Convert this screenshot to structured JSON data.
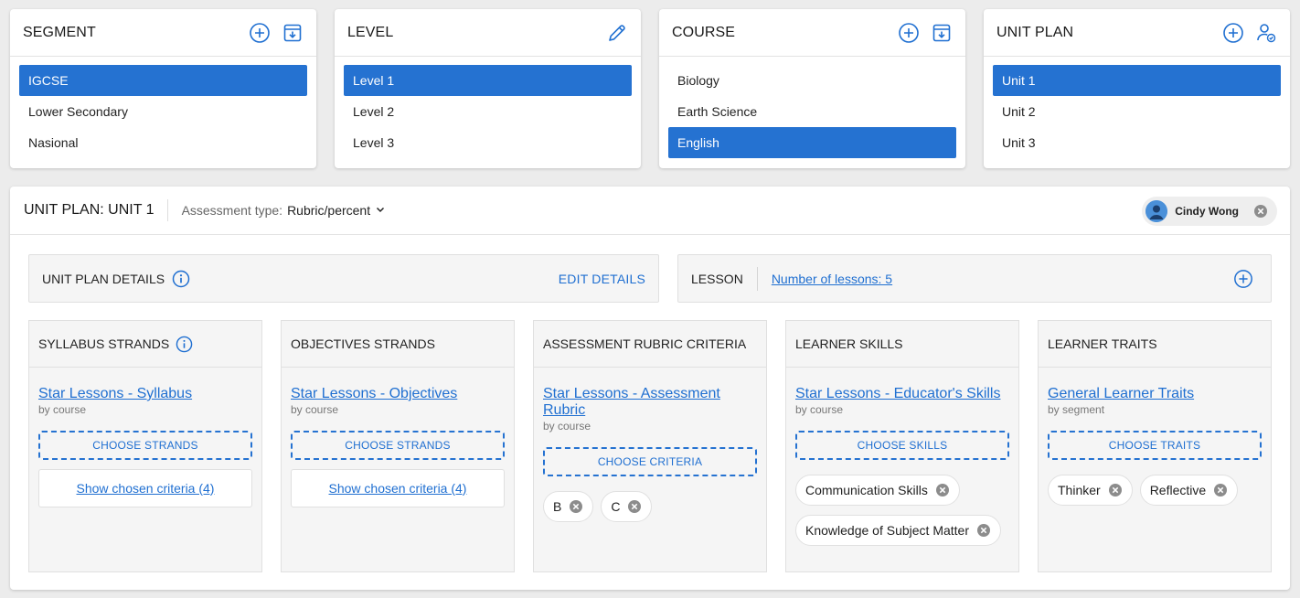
{
  "segment": {
    "title": "SEGMENT",
    "items": [
      "IGCSE",
      "Lower Secondary",
      "Nasional"
    ],
    "selected": 0
  },
  "level": {
    "title": "LEVEL",
    "items": [
      "Level 1",
      "Level 2",
      "Level 3"
    ],
    "selected": 0
  },
  "course": {
    "title": "COURSE",
    "items": [
      "Biology",
      "Earth Science",
      "English"
    ],
    "selected": 2
  },
  "unit_plan": {
    "title": "UNIT PLAN",
    "items": [
      "Unit 1",
      "Unit 2",
      "Unit 3"
    ],
    "selected": 0
  },
  "main": {
    "title": "UNIT PLAN: UNIT 1",
    "assessment_label": "Assessment type:",
    "assessment_value": "Rubric/percent",
    "user_name": "Cindy Wong"
  },
  "details": {
    "label": "UNIT PLAN DETAILS",
    "edit": "EDIT DETAILS"
  },
  "lesson": {
    "label": "LESSON",
    "link": "Number of lessons: 5"
  },
  "columns": [
    {
      "header": "SYLLABUS STRANDS",
      "link": "Star Lessons - Syllabus",
      "sub": "by course",
      "button": "CHOOSE STRANDS",
      "show": "Show chosen criteria (4)"
    },
    {
      "header": "OBJECTIVES STRANDS",
      "link": "Star Lessons - Objectives",
      "sub": "by course",
      "button": "CHOOSE STRANDS",
      "show": "Show chosen criteria (4)"
    },
    {
      "header": "ASSESSMENT RUBRIC CRITERIA",
      "link": "Star Lessons - Assessment Rubric",
      "sub": "by course",
      "button": "CHOOSE CRITERIA",
      "chips": [
        "B",
        "C"
      ]
    },
    {
      "header": "LEARNER SKILLS",
      "link": "Star Lessons - Educator's Skills",
      "sub": "by course",
      "button": "CHOOSE SKILLS",
      "chips": [
        "Communication Skills",
        "Knowledge of Subject Matter"
      ]
    },
    {
      "header": "LEARNER TRAITS",
      "link": "General Learner Traits",
      "sub": "by segment",
      "button": "CHOOSE TRAITS",
      "chips": [
        "Thinker",
        "Reflective"
      ]
    }
  ],
  "colors": {
    "accent": "#2572d1",
    "link": "#1f6fd1"
  }
}
